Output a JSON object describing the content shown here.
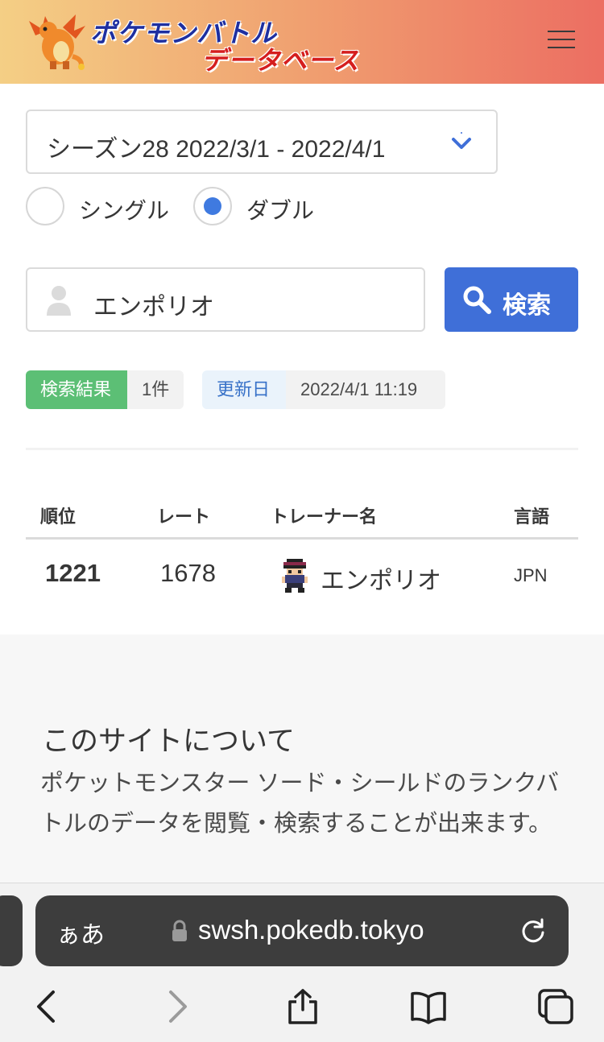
{
  "header": {
    "logo_line1": "ポケモンバトル",
    "logo_line2": "データベース",
    "menu_icon": "hamburger-icon",
    "gradient": [
      "#f4cf85",
      "#ec6e62"
    ]
  },
  "filters": {
    "season_selected": "シーズン28  2022/3/1 - 2022/4/1",
    "battle_types": [
      {
        "label": "シングル",
        "checked": false
      },
      {
        "label": "ダブル",
        "checked": true
      }
    ]
  },
  "search": {
    "value": "エンポリオ",
    "button_label": "検索",
    "accent": "#3f6fd8"
  },
  "result_tags": {
    "count_label": "検索結果",
    "count_value": "1件",
    "updated_label": "更新日",
    "updated_value": "2022/4/1 11:19"
  },
  "table": {
    "headers": [
      "順位",
      "レート",
      "トレーナー名",
      "言語"
    ],
    "rows": [
      {
        "rank": "1221",
        "rate": "1678",
        "trainer": "エンポリオ",
        "lang": "JPN"
      }
    ]
  },
  "about": {
    "title": "このサイトについて",
    "body": "ポケットモンスター ソード・シールドのランクバトルのデータを閲覧・検索することが出来ます。"
  },
  "browser": {
    "aa_label": "ぁあ",
    "url": "swsh.pokedb.tokyo",
    "toolbar_icons": [
      "back-icon",
      "forward-icon",
      "share-icon",
      "bookmarks-icon",
      "tabs-icon"
    ]
  }
}
